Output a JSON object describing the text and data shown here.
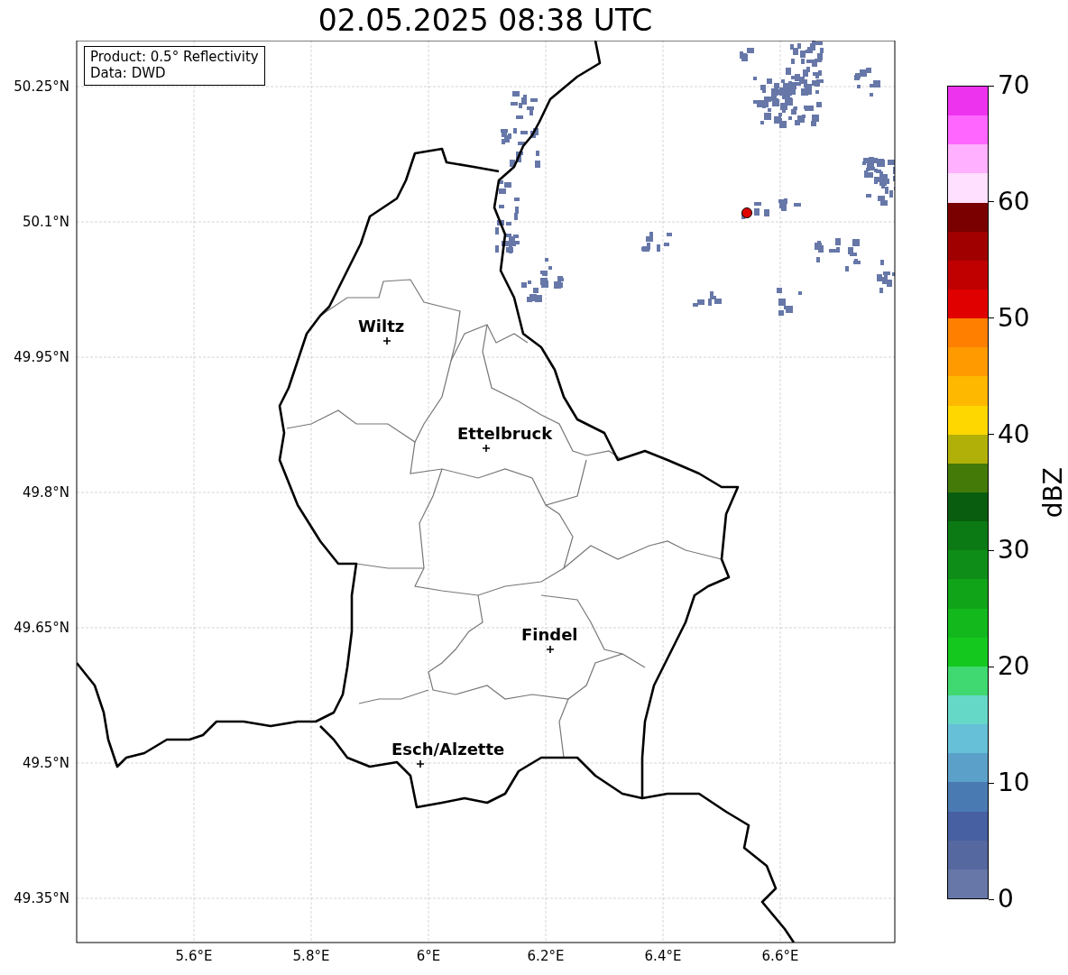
{
  "title": "02.05.2025 08:38 UTC",
  "info_box": {
    "lines": [
      "Product: 0.5° Reflectivity",
      "Data: DWD"
    ]
  },
  "map": {
    "yticks": [
      "50.25°N",
      "50.1°N",
      "49.95°N",
      "49.8°N",
      "49.65°N",
      "49.5°N",
      "49.35°N"
    ],
    "xticks": [
      "5.6°E",
      "5.8°E",
      "6°E",
      "6.2°E",
      "6.4°E",
      "6.6°E"
    ],
    "cities": [
      {
        "name": "Wiltz"
      },
      {
        "name": "Ettelbruck"
      },
      {
        "name": "Findel"
      },
      {
        "name": "Esch/Alzette"
      }
    ]
  },
  "colorbar": {
    "label": "dBZ",
    "ticks": [
      "70",
      "60",
      "50",
      "40",
      "30",
      "20",
      "10",
      "0"
    ],
    "bands": [
      {
        "color": "#ee33ee"
      },
      {
        "color": "#ff66ff"
      },
      {
        "color": "#ffb0ff"
      },
      {
        "color": "#ffe0ff"
      },
      {
        "color": "#7a0000"
      },
      {
        "color": "#a00000"
      },
      {
        "color": "#c00000"
      },
      {
        "color": "#e00000"
      },
      {
        "color": "#ff7f00"
      },
      {
        "color": "#ff9a00"
      },
      {
        "color": "#ffb800"
      },
      {
        "color": "#ffd700"
      },
      {
        "color": "#b0b008"
      },
      {
        "color": "#447a08"
      },
      {
        "color": "#085e0e"
      },
      {
        "color": "#0c7a14"
      },
      {
        "color": "#0e8e18"
      },
      {
        "color": "#10a418"
      },
      {
        "color": "#12b81c"
      },
      {
        "color": "#14c81e"
      },
      {
        "color": "#40d870"
      },
      {
        "color": "#66d8c8"
      },
      {
        "color": "#66c0d8"
      },
      {
        "color": "#5aa0c8"
      },
      {
        "color": "#4a7ab2"
      },
      {
        "color": "#4660a2"
      },
      {
        "color": "#5568a0"
      },
      {
        "color": "#6677a8"
      }
    ]
  }
}
